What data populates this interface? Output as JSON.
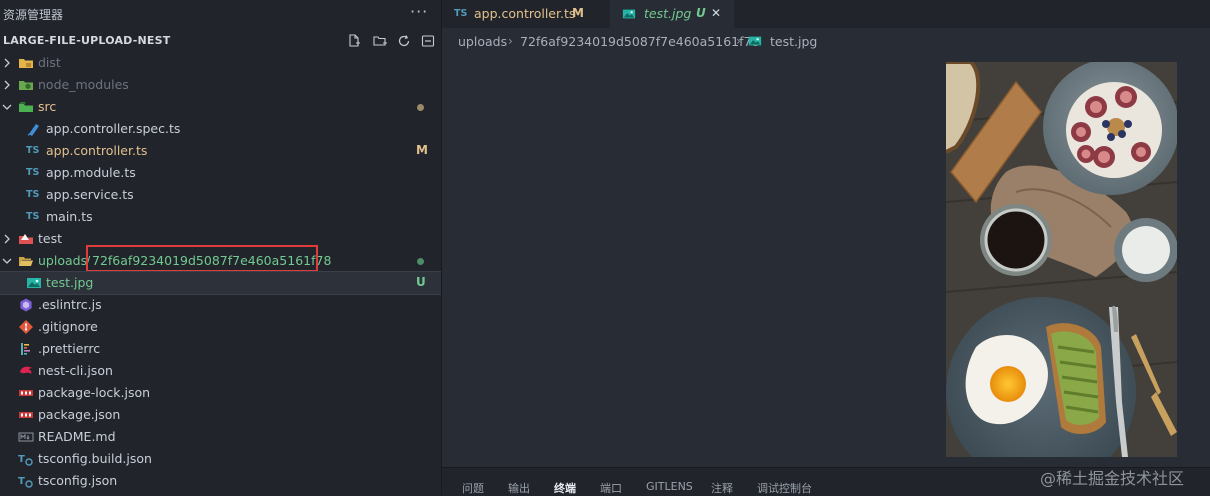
{
  "sidebar": {
    "title": "资源管理器",
    "more": "···",
    "project_name": "LARGE-FILE-UPLOAD-NEST",
    "actions": [
      "new-file-icon",
      "new-folder-icon",
      "refresh-icon",
      "collapse-all-icon"
    ]
  },
  "tree": [
    {
      "label": "dist",
      "kind": "folder",
      "expanded": false,
      "icon": "dist-folder-icon",
      "status": "ignored"
    },
    {
      "label": "node_modules",
      "kind": "folder",
      "expanded": false,
      "icon": "node-folder-icon",
      "status": "ignored"
    },
    {
      "label": "src",
      "kind": "folder",
      "expanded": true,
      "icon": "src-folder-icon",
      "status": "modified-dot"
    },
    {
      "label": "app.controller.spec.ts",
      "kind": "file",
      "icon": "spec-test-icon"
    },
    {
      "label": "app.controller.ts",
      "kind": "file",
      "icon": "ts-file-icon",
      "badge": "M"
    },
    {
      "label": "app.module.ts",
      "kind": "file",
      "icon": "ts-file-icon"
    },
    {
      "label": "app.service.ts",
      "kind": "file",
      "icon": "ts-file-icon"
    },
    {
      "label": "main.ts",
      "kind": "file",
      "icon": "ts-file-icon"
    },
    {
      "label": "test",
      "kind": "folder",
      "expanded": false,
      "icon": "test-folder-icon"
    },
    {
      "label": "uploads",
      "kind": "folder",
      "expanded": true,
      "icon": "folder-open-icon",
      "status": "untracked-dot",
      "subfolder": "72f6af9234019d5087f7e460a5161f78"
    },
    {
      "label": "test.jpg",
      "kind": "file",
      "icon": "image-file-icon",
      "badge": "U",
      "selected": true
    },
    {
      "label": ".eslintrc.js",
      "kind": "file",
      "icon": "eslint-icon"
    },
    {
      "label": ".gitignore",
      "kind": "file",
      "icon": "git-icon"
    },
    {
      "label": ".prettierrc",
      "kind": "file",
      "icon": "prettier-icon"
    },
    {
      "label": "nest-cli.json",
      "kind": "file",
      "icon": "nest-icon"
    },
    {
      "label": "package-lock.json",
      "kind": "file",
      "icon": "npm-icon"
    },
    {
      "label": "package.json",
      "kind": "file",
      "icon": "npm-icon"
    },
    {
      "label": "README.md",
      "kind": "file",
      "icon": "markdown-icon"
    },
    {
      "label": "tsconfig.build.json",
      "kind": "file",
      "icon": "tsconfig-icon"
    },
    {
      "label": "tsconfig.json",
      "kind": "file",
      "icon": "tsconfig-icon"
    }
  ],
  "tabs": [
    {
      "icon_text": "TS",
      "label": "app.controller.ts",
      "badge": "M",
      "active": false
    },
    {
      "label": "test.jpg",
      "badge": "U",
      "close": "✕",
      "active": true
    }
  ],
  "breadcrumb": {
    "items": [
      "uploads",
      "72f6af9234019d5087f7e460a5161f78",
      "test.jpg"
    ],
    "separator": "›"
  },
  "editor": {
    "image_name": "test.jpg",
    "image_description": "breakfast-photo"
  },
  "panel": {
    "tabs": [
      "问题",
      "输出",
      "终端",
      "端口",
      "GITLENS",
      "注释",
      "调试控制台"
    ],
    "active": "终端"
  },
  "watermark": "@稀土掘金技术社区",
  "colors": {
    "sidebar_bg": "#21252b",
    "editor_bg": "#282c34",
    "modified": "#e2c08d",
    "untracked": "#73c991",
    "highlight_box": "#e03c3c",
    "ts_blue": "#519aba"
  }
}
